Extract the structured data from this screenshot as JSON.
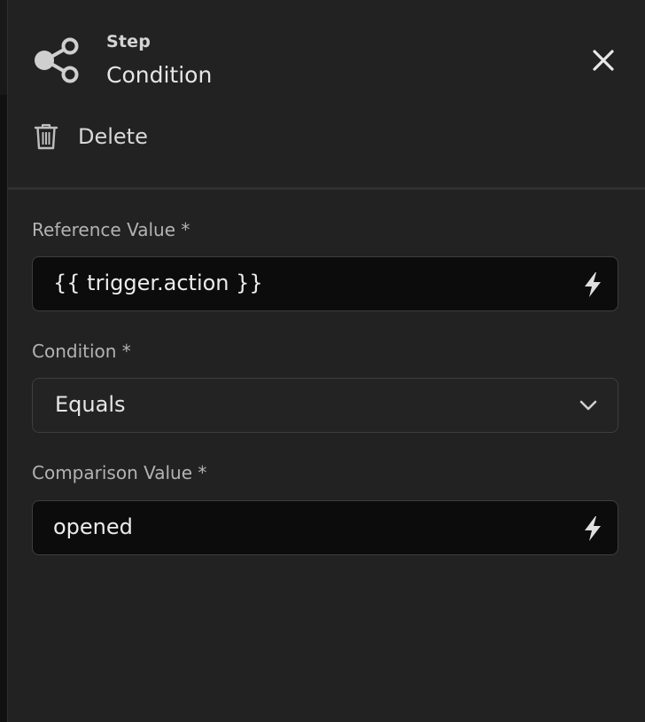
{
  "step": {
    "kind": "Step",
    "title": "Condition",
    "icon": "share-nodes-icon"
  },
  "actions": {
    "delete_label": "Delete"
  },
  "fields": {
    "reference": {
      "label": "Reference Value *",
      "value": "{{ trigger.action }}",
      "icon": "lightning-icon"
    },
    "condition": {
      "label": "Condition *",
      "selected": "Equals",
      "icon": "chevron-down-icon"
    },
    "comparison": {
      "label": "Comparison Value *",
      "value": "opened",
      "icon": "lightning-icon"
    }
  },
  "colors": {
    "panel_background": "#222222",
    "input_background": "#0c0c0c",
    "input_border": "#3e3e3e",
    "label_text": "#b3b3b3"
  }
}
